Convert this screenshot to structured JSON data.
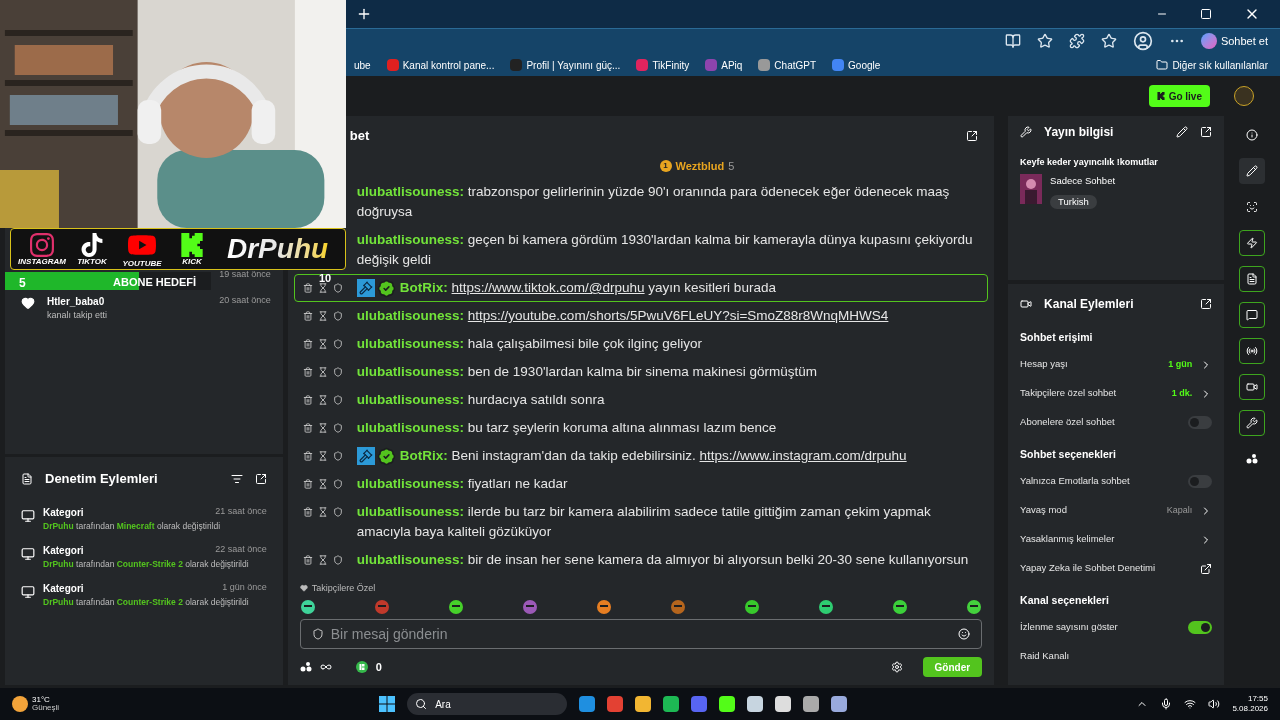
{
  "browser": {
    "bookmarks": [
      {
        "label": "ube"
      },
      {
        "label": "Kanal kontrol pane..."
      },
      {
        "label": "Profil | Yayınını güç..."
      },
      {
        "label": "TikFinity"
      },
      {
        "label": "APiq"
      },
      {
        "label": "ChatGPT"
      },
      {
        "label": "Google"
      }
    ],
    "other_bookmarks": "Diğer sık kullanılanlar",
    "copilot": "Sohbet et"
  },
  "topbar": {
    "go_live": "Go live"
  },
  "overlay": {
    "socials": [
      "INSTAGRAM",
      "TIKTOK",
      "YOUTUBE",
      "KICK"
    ],
    "logo": "DrPuhu",
    "goal": {
      "count": "5",
      "label": "ABONE HEDEFİ",
      "level": 0.65
    },
    "counter": "10"
  },
  "activity": [
    {
      "time": "19 saat önce"
    },
    {
      "name": "Htler_baba0",
      "text": "kanalı takip etti",
      "time": "20 saat önce"
    }
  ],
  "moderation": {
    "title": "Denetim Eylemleri",
    "items": [
      {
        "title": "Kategori",
        "time": "21 saat önce",
        "user": "DrPuhu",
        "middle": "tarafından",
        "target": "Minecraft",
        "end": "olarak değiştirildi"
      },
      {
        "title": "Kategori",
        "time": "22 saat önce",
        "user": "DrPuhu",
        "middle": "tarafından",
        "target": "Counter-Strike 2",
        "end": "olarak değiştirildi"
      },
      {
        "title": "Kategori",
        "time": "1 gün önce",
        "user": "DrPuhu",
        "middle": "tarafından",
        "target": "Counter-Strike 2",
        "end": "olarak değiştirildi"
      }
    ]
  },
  "chat": {
    "title": "bet",
    "gifter": {
      "rank": "1",
      "name": "Weztblud",
      "count": "5"
    },
    "messages": [
      {
        "kind": "user",
        "tools": false,
        "highlighted": false,
        "user": "ulubatlisouness:",
        "parts": [
          {
            "kind": "text",
            "text": "trabzonspor gelirlerinin yüzde 90'ı oranında para ödenecek eğer ödenecek maaş doğruysa"
          }
        ]
      },
      {
        "kind": "user",
        "tools": false,
        "highlighted": false,
        "user": "ulubatlisouness:",
        "parts": [
          {
            "kind": "text",
            "text": "geçen bi kamera gördüm 1930'lardan kalma bir kamerayla dünya kupasını çekiyordu değişik geldi"
          }
        ]
      },
      {
        "kind": "bot",
        "tools": true,
        "highlighted": true,
        "user": "BotRix:",
        "parts": [
          {
            "kind": "link",
            "text": "https://www.tiktok.com/@drpuhu"
          },
          {
            "kind": "text",
            "text": "yayın kesitleri burada"
          }
        ]
      },
      {
        "kind": "user",
        "tools": true,
        "highlighted": false,
        "user": "ulubatlisouness:",
        "parts": [
          {
            "kind": "link",
            "text": "https://youtube.com/shorts/5PwuV6FLeUY?si=SmoZ88r8WnqMHWS4"
          }
        ]
      },
      {
        "kind": "user",
        "tools": true,
        "highlighted": false,
        "user": "ulubatlisouness:",
        "parts": [
          {
            "kind": "text",
            "text": "hala çalışabilmesi bile çok ilginç geliyor"
          }
        ]
      },
      {
        "kind": "user",
        "tools": true,
        "highlighted": false,
        "user": "ulubatlisouness:",
        "parts": [
          {
            "kind": "text",
            "text": "ben de 1930'lardan kalma bir sinema makinesi görmüştüm"
          }
        ]
      },
      {
        "kind": "user",
        "tools": true,
        "highlighted": false,
        "user": "ulubatlisouness:",
        "parts": [
          {
            "kind": "text",
            "text": "hurdacıya satıldı sonra"
          }
        ]
      },
      {
        "kind": "user",
        "tools": true,
        "highlighted": false,
        "user": "ulubatlisouness:",
        "parts": [
          {
            "kind": "text",
            "text": "bu tarz şeylerin koruma altına alınması lazım bence"
          }
        ]
      },
      {
        "kind": "bot",
        "tools": true,
        "highlighted": false,
        "user": "BotRix:",
        "parts": [
          {
            "kind": "text",
            "text": "Beni instagram'dan da takip edebilirsiniz."
          },
          {
            "kind": "link",
            "text": "https://www.instagram.com/drpuhu"
          }
        ]
      },
      {
        "kind": "user",
        "tools": true,
        "highlighted": false,
        "user": "ulubatlisouness:",
        "parts": [
          {
            "kind": "text",
            "text": "fiyatları ne kadar"
          }
        ]
      },
      {
        "kind": "user",
        "tools": true,
        "highlighted": false,
        "user": "ulubatlisouness:",
        "parts": [
          {
            "kind": "text",
            "text": "ilerde bu tarz bir kamera alabilirim sadece tatile gittiğim zaman çekim yapmak amacıyla baya kaliteli gözüküyor"
          }
        ]
      },
      {
        "kind": "user",
        "tools": true,
        "highlighted": false,
        "user": "ulubatlisouness:",
        "parts": [
          {
            "kind": "text",
            "text": "bir de insan her sene kamera da almıyor bi alıyorsun belki 20-30 sene kullanıyorsun"
          }
        ]
      }
    ],
    "emote_label": "Takipçilere Özel",
    "placeholder": "Bir mesaj gönderin",
    "coins": "0",
    "send": "Gönder"
  },
  "stream_info": {
    "title": "Yayın bilgisi",
    "stream_title": "Keyfe keder yayıncılık !komutlar",
    "category": "Sadece Sohbet",
    "tag": "Turkish"
  },
  "channel_actions": {
    "title": "Kanal Eylemleri",
    "sections": [
      {
        "title": "Sohbet erişimi",
        "rows": [
          {
            "kind": "value",
            "label": "Hesap yaşı",
            "value": "1 gün",
            "accent": true
          },
          {
            "kind": "value",
            "label": "Takipçilere özel sohbet",
            "value": "1 dk.",
            "accent": true
          },
          {
            "kind": "toggle",
            "label": "Abonelere özel sohbet",
            "on": false
          }
        ]
      },
      {
        "title": "Sohbet seçenekleri",
        "rows": [
          {
            "kind": "toggle",
            "label": "Yalnızca Emotlarla sohbet",
            "on": false
          },
          {
            "kind": "value",
            "label": "Yavaş mod",
            "value": "Kapalı",
            "accent": false
          },
          {
            "kind": "chevron",
            "label": "Yasaklanmış kelimeler"
          },
          {
            "kind": "external",
            "label": "Yapay Zeka ile Sohbet Denetimi"
          }
        ]
      },
      {
        "title": "Kanal seçenekleri",
        "rows": [
          {
            "kind": "toggle",
            "label": "İzlenme sayısını göster",
            "on": true
          },
          {
            "kind": "plain",
            "label": "Raid Kanalı"
          }
        ]
      }
    ]
  },
  "rail": [
    {
      "kind": "info",
      "active": false,
      "selected": false
    },
    {
      "kind": "pencil",
      "active": false,
      "selected": true
    },
    {
      "kind": "capture",
      "active": false,
      "selected": false
    },
    {
      "kind": "zap",
      "active": true,
      "selected": false
    },
    {
      "kind": "doc",
      "active": true,
      "selected": false
    },
    {
      "kind": "chat",
      "active": true,
      "selected": false
    },
    {
      "kind": "broadcast",
      "active": true,
      "selected": false
    },
    {
      "kind": "camera",
      "active": true,
      "selected": false
    },
    {
      "kind": "wrench",
      "active": true,
      "selected": false
    },
    {
      "kind": "dots",
      "active": false,
      "selected": false
    }
  ],
  "taskbar": {
    "temp": "31°C",
    "weather": "Güneşli",
    "search": "Ara",
    "time": "17:55",
    "date": "5.08.2026"
  }
}
